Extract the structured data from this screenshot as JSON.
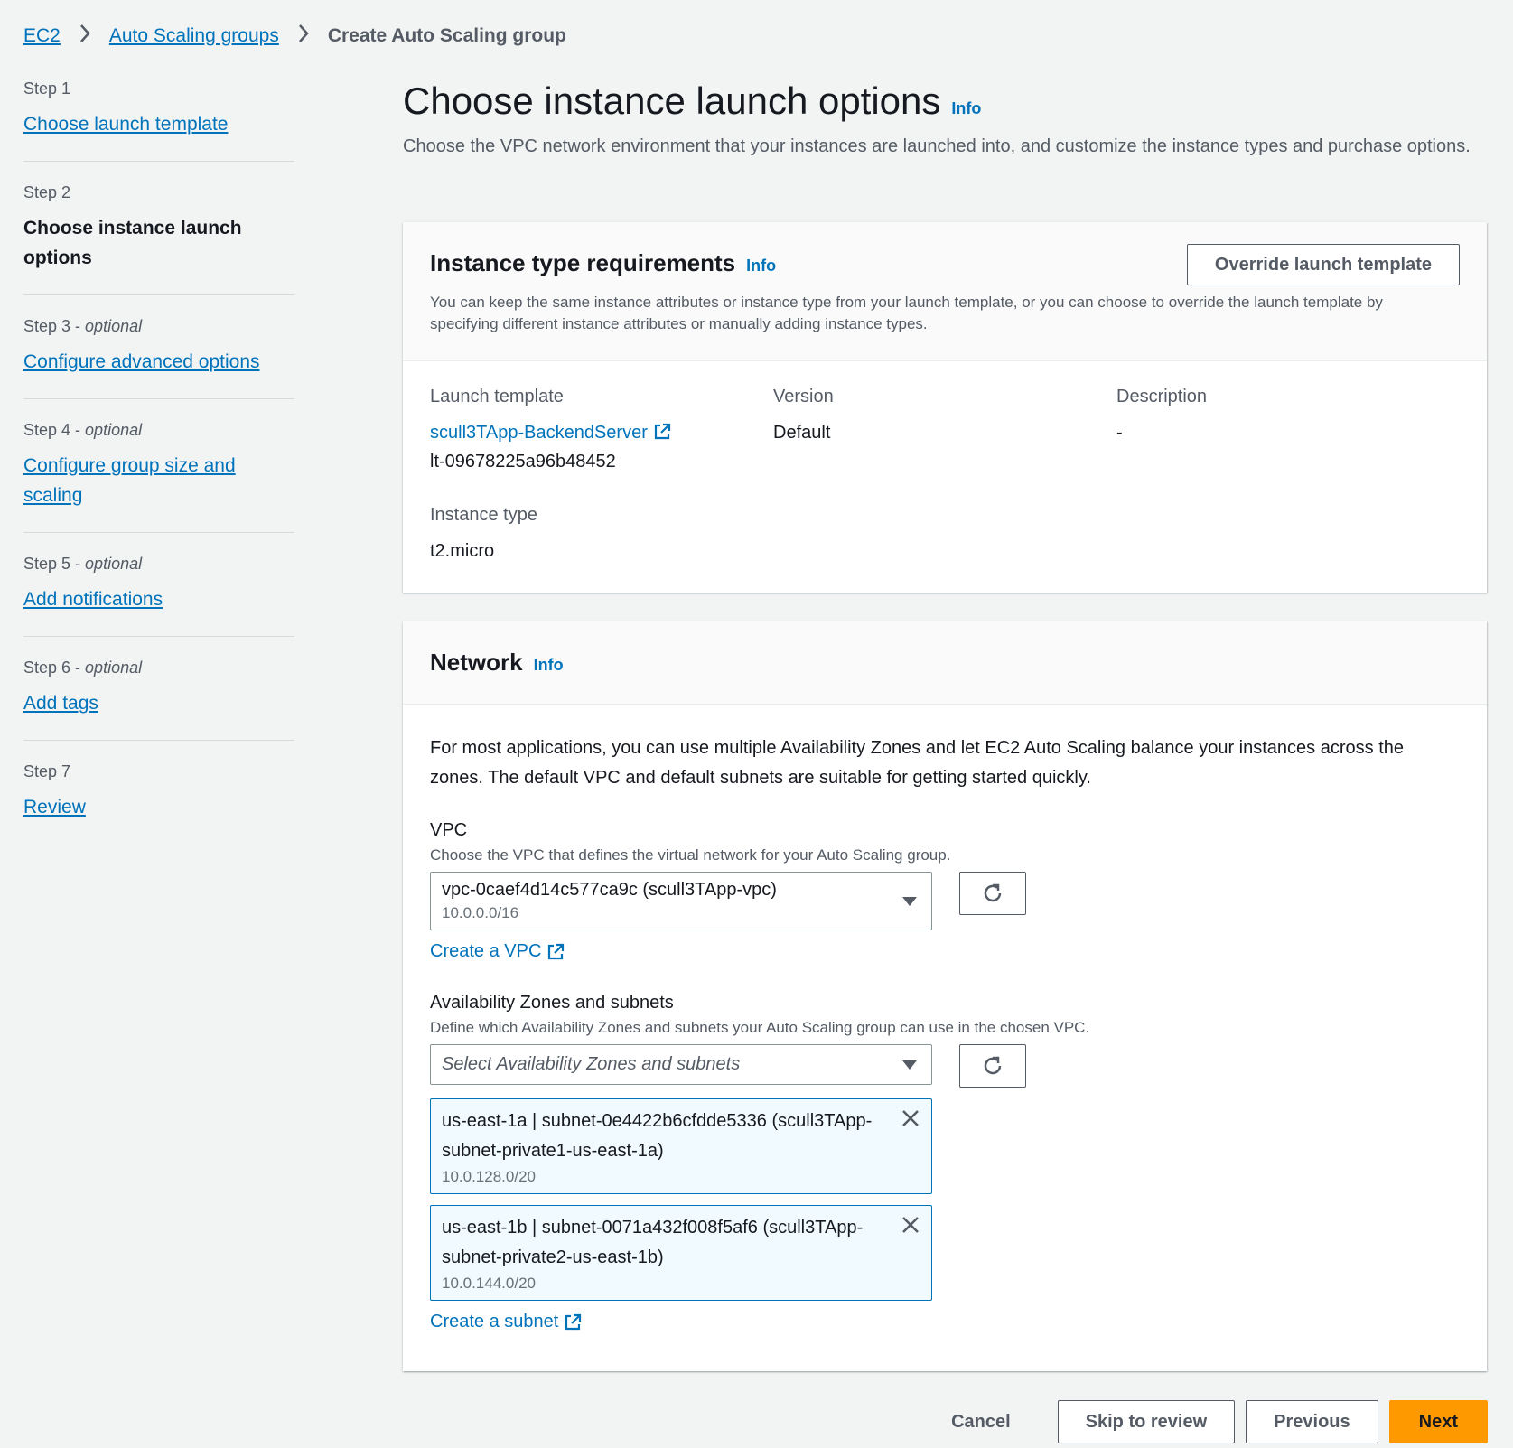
{
  "breadcrumb": {
    "items": [
      "EC2",
      "Auto Scaling groups"
    ],
    "current": "Create Auto Scaling group"
  },
  "steps": [
    {
      "num": "Step 1",
      "optional": "",
      "title": "Choose launch template"
    },
    {
      "num": "Step 2",
      "optional": "",
      "title": "Choose instance launch options"
    },
    {
      "num": "Step 3 - ",
      "optional": "optional",
      "title": "Configure advanced options"
    },
    {
      "num": "Step 4 - ",
      "optional": "optional",
      "title": "Configure group size and scaling"
    },
    {
      "num": "Step 5 - ",
      "optional": "optional",
      "title": "Add notifications"
    },
    {
      "num": "Step 6 - ",
      "optional": "optional",
      "title": "Add tags"
    },
    {
      "num": "Step 7",
      "optional": "",
      "title": "Review"
    }
  ],
  "page": {
    "title": "Choose instance launch options",
    "info": "Info",
    "description": "Choose the VPC network environment that your instances are launched into, and customize the instance types and purchase options."
  },
  "instance_panel": {
    "title": "Instance type requirements",
    "info": "Info",
    "override_button": "Override launch template",
    "description": "You can keep the same instance attributes or instance type from your launch template, or you can choose to override the launch template by specifying different instance attributes or manually adding instance types.",
    "launch_template_label": "Launch template",
    "launch_template_name": "scull3TApp-BackendServer",
    "launch_template_id": "lt-09678225a96b48452",
    "version_label": "Version",
    "version_value": "Default",
    "description_label": "Description",
    "description_value": "-",
    "instance_type_label": "Instance type",
    "instance_type_value": "t2.micro"
  },
  "network_panel": {
    "title": "Network",
    "info": "Info",
    "intro": "For most applications, you can use multiple Availability Zones and let EC2 Auto Scaling balance your instances across the zones. The default VPC and default subnets are suitable for getting started quickly.",
    "vpc_label": "VPC",
    "vpc_desc": "Choose the VPC that defines the virtual network for your Auto Scaling group.",
    "vpc_value": "vpc-0caef4d14c577ca9c (scull3TApp-vpc)",
    "vpc_cidr": "10.0.0.0/16",
    "create_vpc": "Create a VPC",
    "az_label": "Availability Zones and subnets",
    "az_desc": "Define which Availability Zones and subnets your Auto Scaling group can use in the chosen VPC.",
    "az_placeholder": "Select Availability Zones and subnets",
    "subnets": [
      {
        "name": "us-east-1a | subnet-0e4422b6cfdde5336 (scull3TApp-subnet-private1-us-east-1a)",
        "cidr": "10.0.128.0/20"
      },
      {
        "name": "us-east-1b | subnet-0071a432f008f5af6 (scull3TApp-subnet-private2-us-east-1b)",
        "cidr": "10.0.144.0/20"
      }
    ],
    "create_subnet": "Create a subnet"
  },
  "footer": {
    "cancel": "Cancel",
    "skip": "Skip to review",
    "previous": "Previous",
    "next": "Next"
  },
  "colors": {
    "link": "#0073bb",
    "primary": "#ff9900",
    "background": "#f2f3f3"
  }
}
